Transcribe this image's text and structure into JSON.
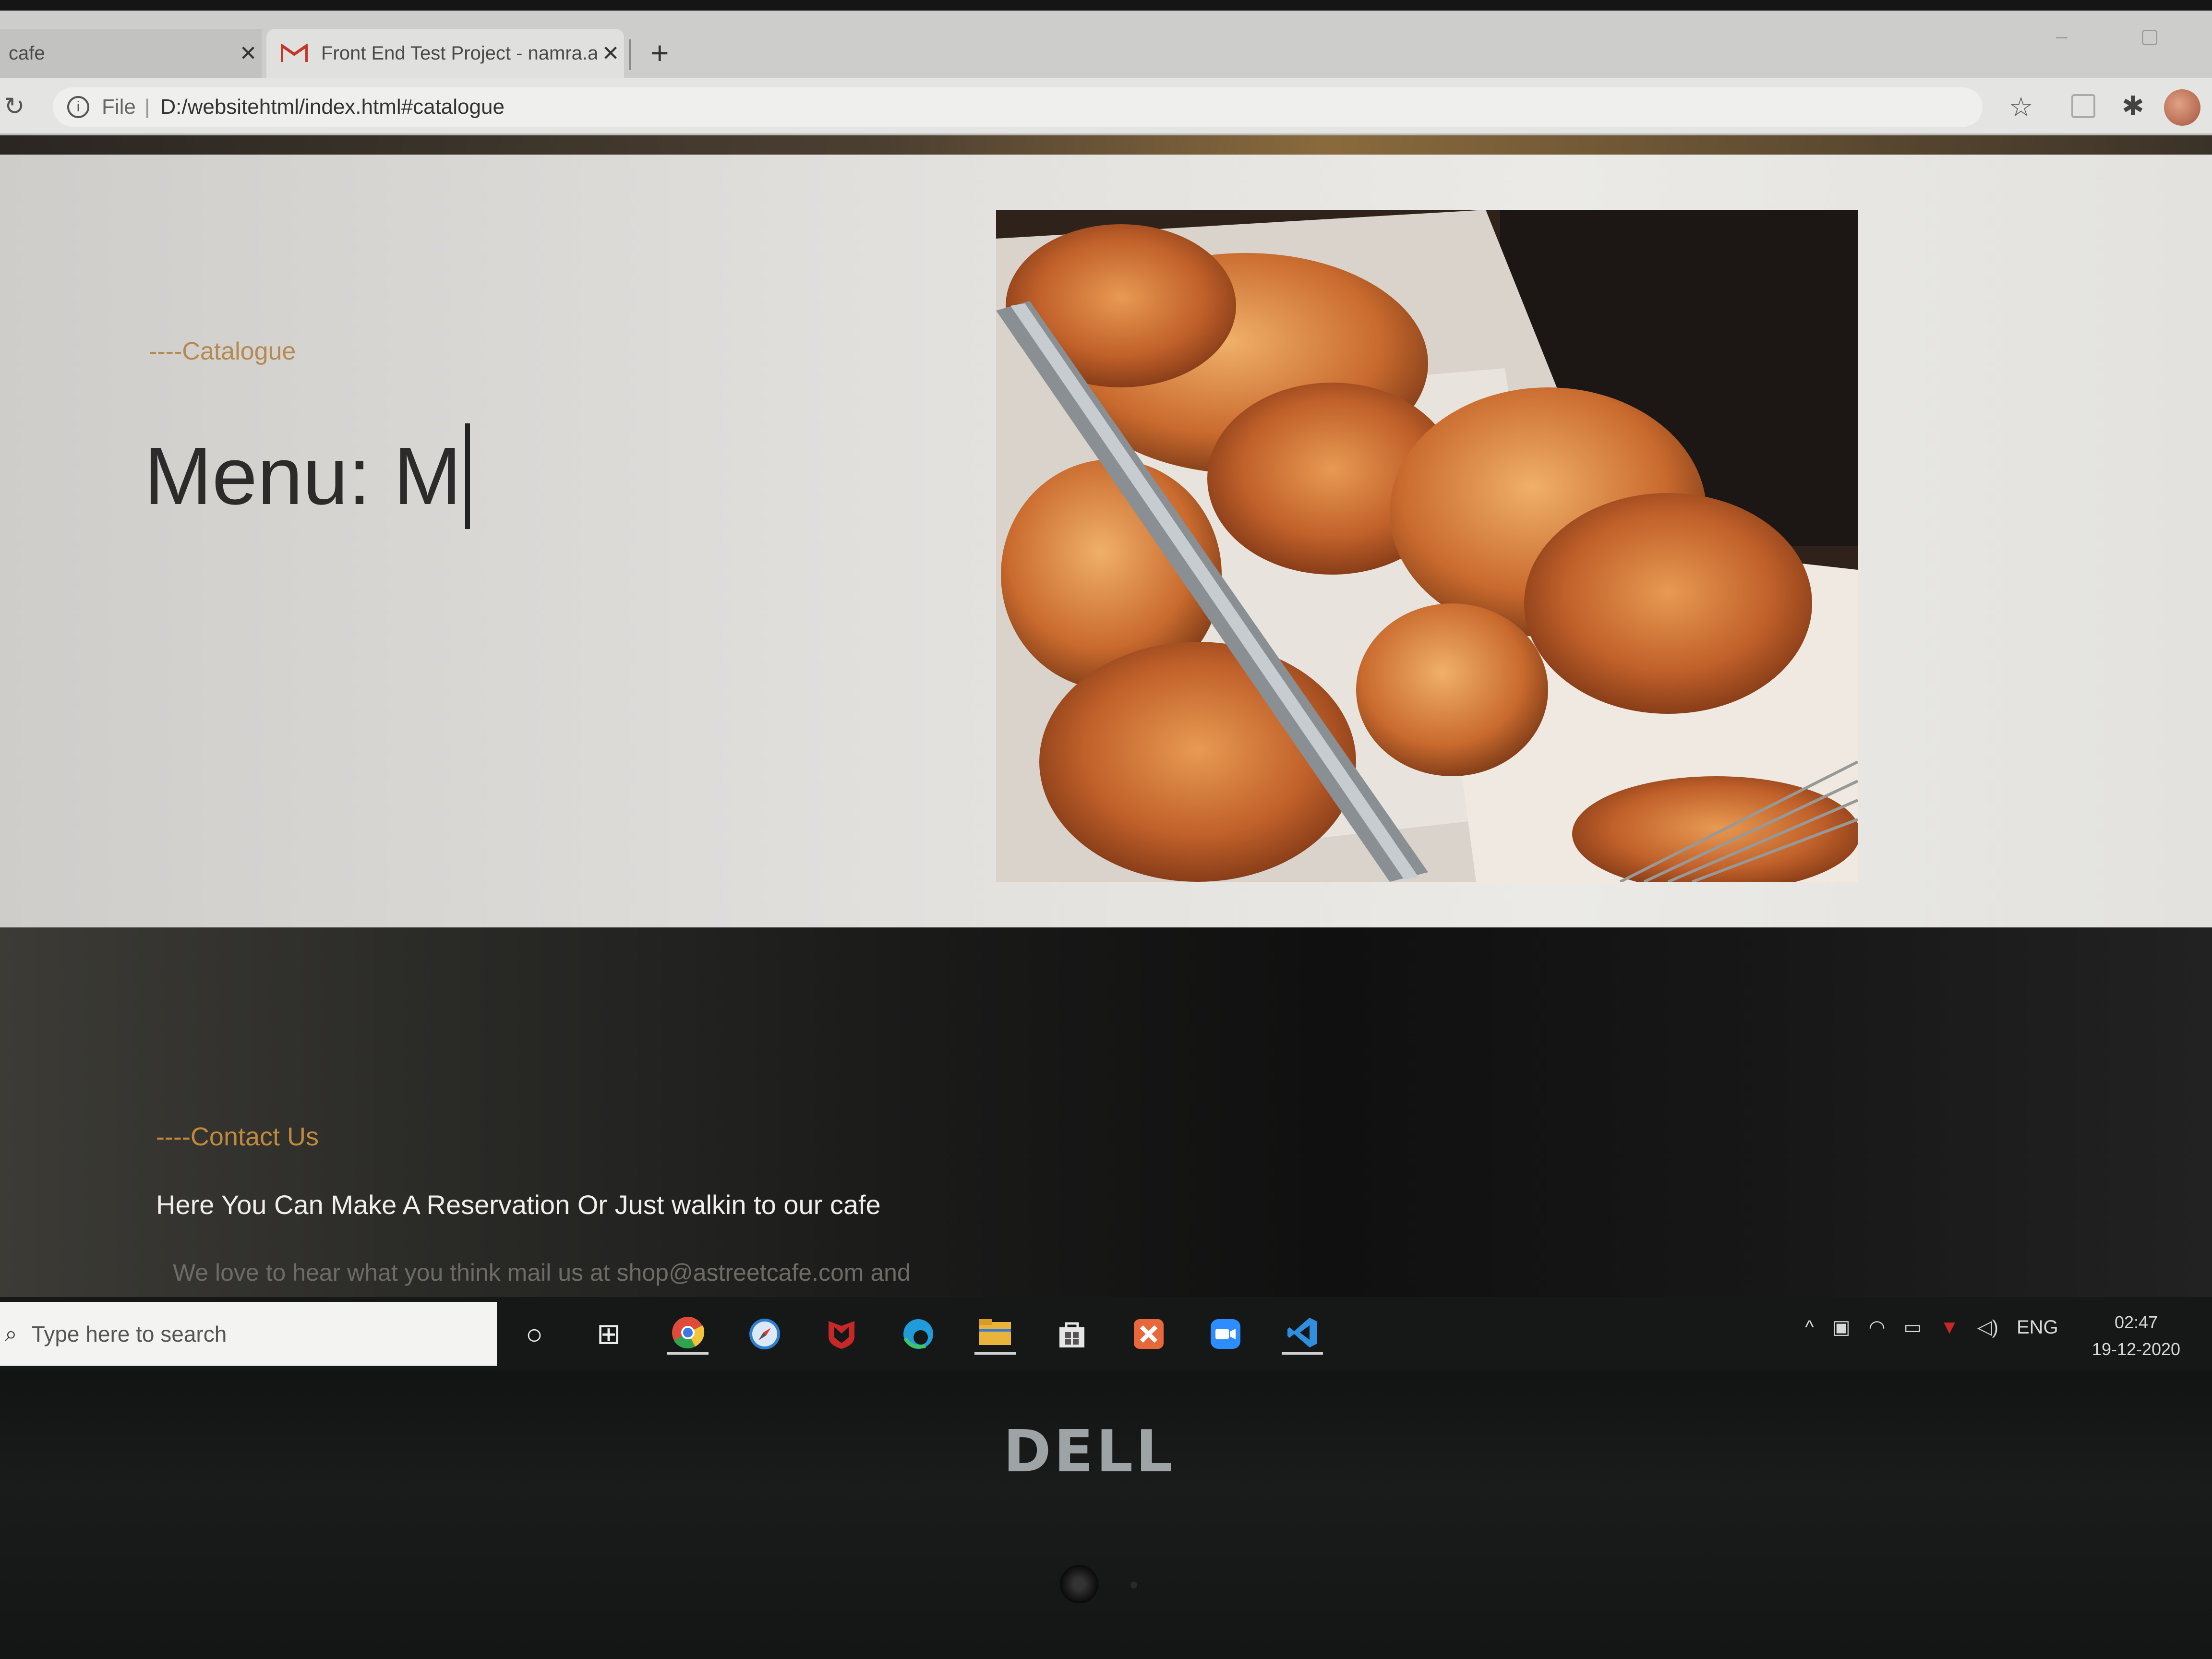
{
  "browser": {
    "tabs": [
      {
        "label": "cafe",
        "close": "✕"
      },
      {
        "label": "Front End Test Project - namra.ac",
        "close": "✕"
      }
    ],
    "new_tab": "+",
    "reload": "↻",
    "info": "i",
    "file_label": "File",
    "url_separator": "|",
    "url": "D:/websitehtml/index.html#catalogue",
    "star": "☆",
    "puzzle": "✱",
    "window_controls": "– ▢"
  },
  "page": {
    "catalogue_eyebrow": "----Catalogue",
    "menu_heading": "Menu: M",
    "contact_eyebrow": "----Contact Us",
    "contact_title": "Here You Can Make A Reservation Or Just walkin to our cafe",
    "contact_body": "We love to hear what you think mail us at shop@astreetcafe.com and"
  },
  "taskbar": {
    "search_placeholder": "Type here to search",
    "search_icon": "⌕",
    "cortana": "○",
    "task_view": "⊞",
    "apps": [
      "chrome-icon",
      "safari-icon",
      "mcafee-icon",
      "edge-icon",
      "file-explorer-icon",
      "store-icon",
      "xampp-icon",
      "zoom-icon",
      "vscode-icon"
    ],
    "tray": {
      "chevron": "^",
      "language": "ENG"
    },
    "time": "02:47",
    "date": "19-12-2020"
  },
  "hardware": {
    "brand": "DELL"
  }
}
